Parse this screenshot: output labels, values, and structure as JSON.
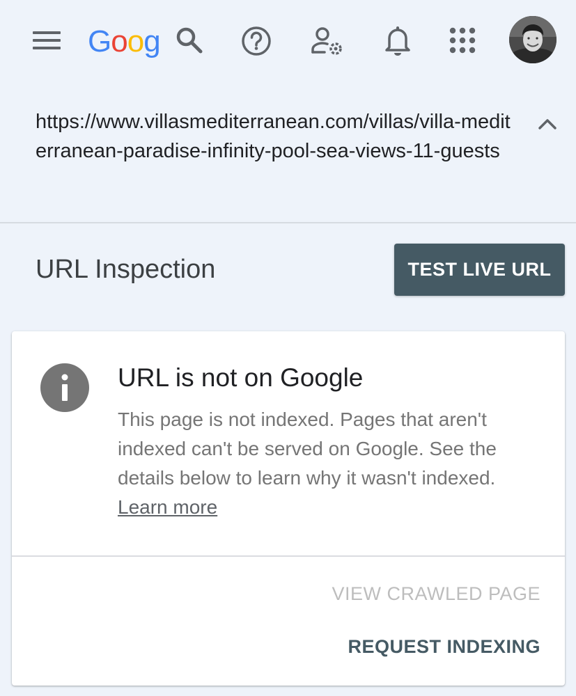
{
  "header": {
    "logo_text": "Google",
    "logo_colors": [
      "#4285F4",
      "#EA4335",
      "#FBBC05",
      "#4285F4",
      "#34A853",
      "#EA4335"
    ],
    "icons": [
      "menu-icon",
      "search-icon",
      "help-icon",
      "user-settings-icon",
      "notifications-icon",
      "apps-icon",
      "avatar"
    ]
  },
  "url_panel": {
    "url": "https://www.villasmediterranean.com/villas/villa-mediterranean-paradise-infinity-pool-sea-views-11-guests"
  },
  "page": {
    "title": "URL Inspection",
    "test_button": "TEST LIVE URL"
  },
  "status_card": {
    "title": "URL is not on Google",
    "description": "This page is not indexed. Pages that aren't indexed can't be served on Google. See the details below to learn why it wasn't indexed.",
    "learn_more": "Learn more",
    "view_crawled_page": "VIEW CRAWLED PAGE",
    "request_indexing": "REQUEST INDEXING"
  },
  "colors": {
    "page_bg": "#eef3fa",
    "button_bg": "#455a64",
    "icon_gray": "#5f6368",
    "info_icon": "#757575",
    "disabled_text": "#bdbdbd"
  }
}
